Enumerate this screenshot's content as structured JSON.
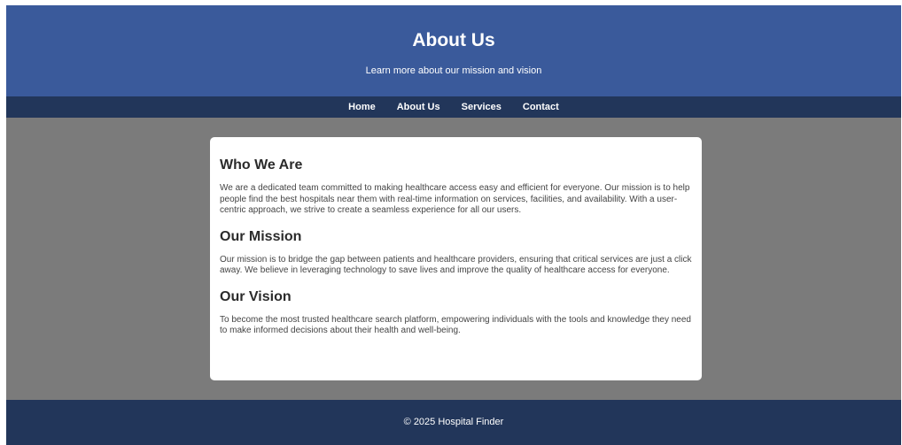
{
  "header": {
    "title": "About Us",
    "subtitle": "Learn more about our mission and vision"
  },
  "nav": {
    "items": [
      {
        "label": "Home"
      },
      {
        "label": "About Us"
      },
      {
        "label": "Services"
      },
      {
        "label": "Contact"
      }
    ]
  },
  "content": {
    "sections": [
      {
        "heading": "Who We Are",
        "body": "We are a dedicated team committed to making healthcare access easy and efficient for everyone. Our mission is to help people find the best hospitals near them with real-time information on services, facilities, and availability. With a user-centric approach, we strive to create a seamless experience for all our users."
      },
      {
        "heading": "Our Mission",
        "body": "Our mission is to bridge the gap between patients and healthcare providers, ensuring that critical services are just a click away. We believe in leveraging technology to save lives and improve the quality of healthcare access for everyone."
      },
      {
        "heading": "Our Vision",
        "body": "To become the most trusted healthcare search platform, empowering individuals with the tools and knowledge they need to make informed decisions about their health and well-being."
      }
    ]
  },
  "footer": {
    "text": "© 2025 Hospital Finder"
  },
  "colors": {
    "header_bg": "#3a5a9b",
    "nav_bg": "#22365a",
    "page_bg": "#7b7b7b",
    "card_bg": "#ffffff",
    "footer_bg": "#22365a"
  }
}
